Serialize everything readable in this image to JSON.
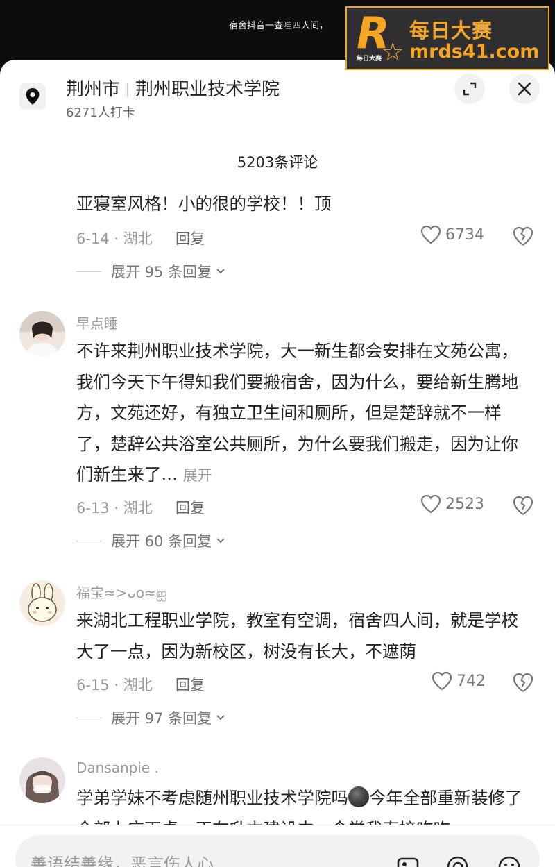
{
  "top_caption": "宿舍抖音一查哇四人间，",
  "watermark": {
    "line1": "每日大赛",
    "line2": "mrds41.com",
    "logo_letter": "R",
    "logo_small": "每日大赛"
  },
  "location": {
    "city": "荆州市",
    "place": "荆州职业技术学院",
    "checkins": "6271人打卡"
  },
  "comment_count": "5203条评论",
  "comments": [
    {
      "username": "",
      "text": "亚寝室风格！小的很的学校！！顶",
      "date_region": "6-14 · 湖北",
      "reply_label": "回复",
      "likes": "6734",
      "expand_replies": "展开 95 条回复"
    },
    {
      "username": "早点睡",
      "text": "不许来荆州职业技术学院，大一新生都会安排在文苑公寓，我们今天下午得知我们要搬宿舍，因为什么，要给新生腾地方，文苑还好，有独立卫生间和厕所，但是楚辞就不一样了，楚辞公共浴室公共厕所，为什么要我们搬走，因为让你们新生来了...",
      "expand_label": "展开",
      "date_region": "6-13 · 湖北",
      "reply_label": "回复",
      "likes": "2523",
      "expand_replies": "展开 60 条回复"
    },
    {
      "username": "福宝≈>ᴗo≈ஐ",
      "text": "来湖北工程职业学院，教室有空调，宿舍四人间，就是学校大了一点，因为新校区，树没有长大，不遮荫",
      "date_region": "6-15 · 湖北",
      "reply_label": "回复",
      "likes": "742",
      "expand_replies": "展开 97 条回复"
    },
    {
      "username": "Dansanpie .",
      "text_before_emoji": "学弟学妹不考虑随州职业技术学院吗",
      "text_after_emoji": "今年全部重新装修了全部上床下桌，正在升本建设中，食堂我直接吃吃",
      "date_region": "",
      "reply_label": "",
      "likes": "",
      "expand_replies": ""
    }
  ],
  "input": {
    "placeholder": "善语结善缘，恶言伤人心"
  },
  "colors": {
    "accent_orange": "#f5a623",
    "text_primary": "#222222",
    "text_secondary": "#999999"
  }
}
